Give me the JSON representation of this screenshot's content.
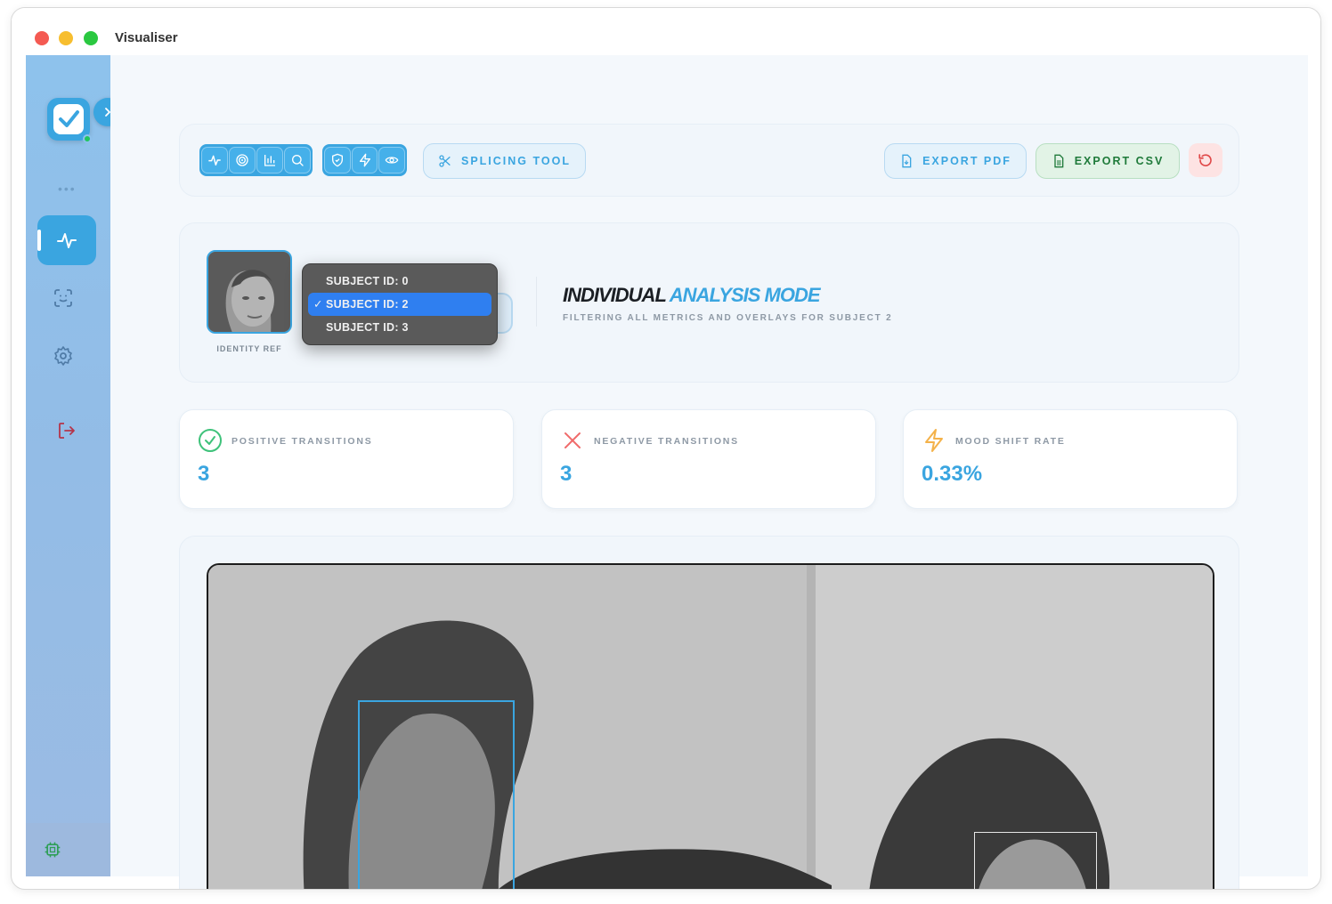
{
  "window": {
    "title": "Visualiser"
  },
  "sidebar": {
    "logo_icon": "check-square-icon",
    "expand_icon": "chevron-right-icon",
    "more_label": "•••",
    "items": [
      {
        "name": "activity",
        "icon": "activity-icon",
        "active": true
      },
      {
        "name": "face-scan",
        "icon": "face-scan-icon",
        "active": false
      },
      {
        "name": "settings",
        "icon": "gear-icon",
        "active": false
      },
      {
        "name": "logout",
        "icon": "logout-icon",
        "active": false
      }
    ],
    "footer_icon": "cpu-icon"
  },
  "toolbar": {
    "group_one": [
      "activity-icon",
      "target-icon",
      "bar-chart-icon",
      "search-icon"
    ],
    "group_two": [
      "shield-icon",
      "lightning-icon",
      "eye-icon"
    ],
    "splicing_label": "SPLICING TOOL",
    "export_pdf_label": "EXPORT PDF",
    "export_csv_label": "EXPORT CSV",
    "reset_icon": "reset-icon"
  },
  "subject": {
    "identity_label": "IDENTITY REF",
    "options": [
      "SUBJECT ID: 0",
      "SUBJECT ID: 2",
      "SUBJECT ID: 3"
    ],
    "selected": "SUBJECT ID: 2",
    "check_mark": "✓"
  },
  "mode": {
    "title_dark": "INDIVIDUAL",
    "title_blue": "ANALYSIS MODE",
    "subtitle": "FILTERING ALL METRICS AND OVERLAYS FOR SUBJECT 2"
  },
  "stats": {
    "positive": {
      "label": "POSITIVE TRANSITIONS",
      "value": "3"
    },
    "negative": {
      "label": "NEGATIVE TRANSITIONS",
      "value": "3"
    },
    "mood": {
      "label": "MOOD SHIFT RATE",
      "value": "0.33%"
    }
  },
  "colors": {
    "accent": "#3aa5e0",
    "positive": "#3ec27a",
    "negative": "#f06b6b",
    "mood": "#f4b24a",
    "sidebar": "#8ec2ec"
  }
}
